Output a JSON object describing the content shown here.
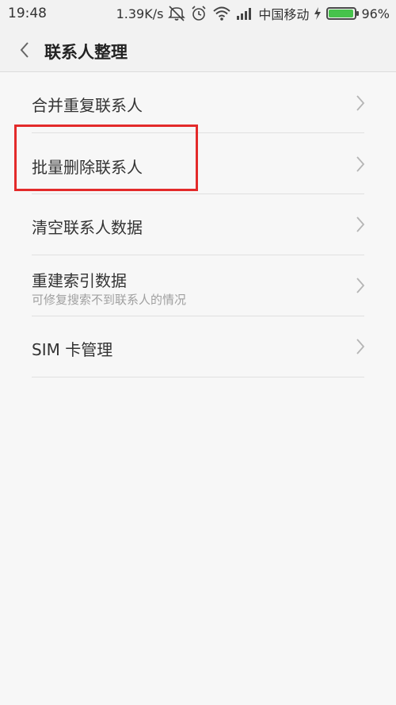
{
  "status_bar": {
    "time": "19:48",
    "speed": "1.39K/s",
    "carrier": "中国移动",
    "battery": "96%",
    "battery_level": 0.96,
    "icons": [
      "mute-icon",
      "alarm-icon",
      "wifi-icon",
      "signal-icon",
      "charging-icon",
      "battery-icon"
    ]
  },
  "header": {
    "title": "联系人整理"
  },
  "list": [
    {
      "label": "合并重复联系人"
    },
    {
      "label": "批量删除联系人"
    },
    {
      "label": "清空联系人数据"
    },
    {
      "label": "重建索引数据",
      "subtitle": "可修复搜索不到联系人的情况"
    },
    {
      "label": "SIM 卡管理"
    }
  ],
  "colors": {
    "highlight": "#e32a2a",
    "battery_green": "#46c34b",
    "background": "#f7f7f7"
  }
}
